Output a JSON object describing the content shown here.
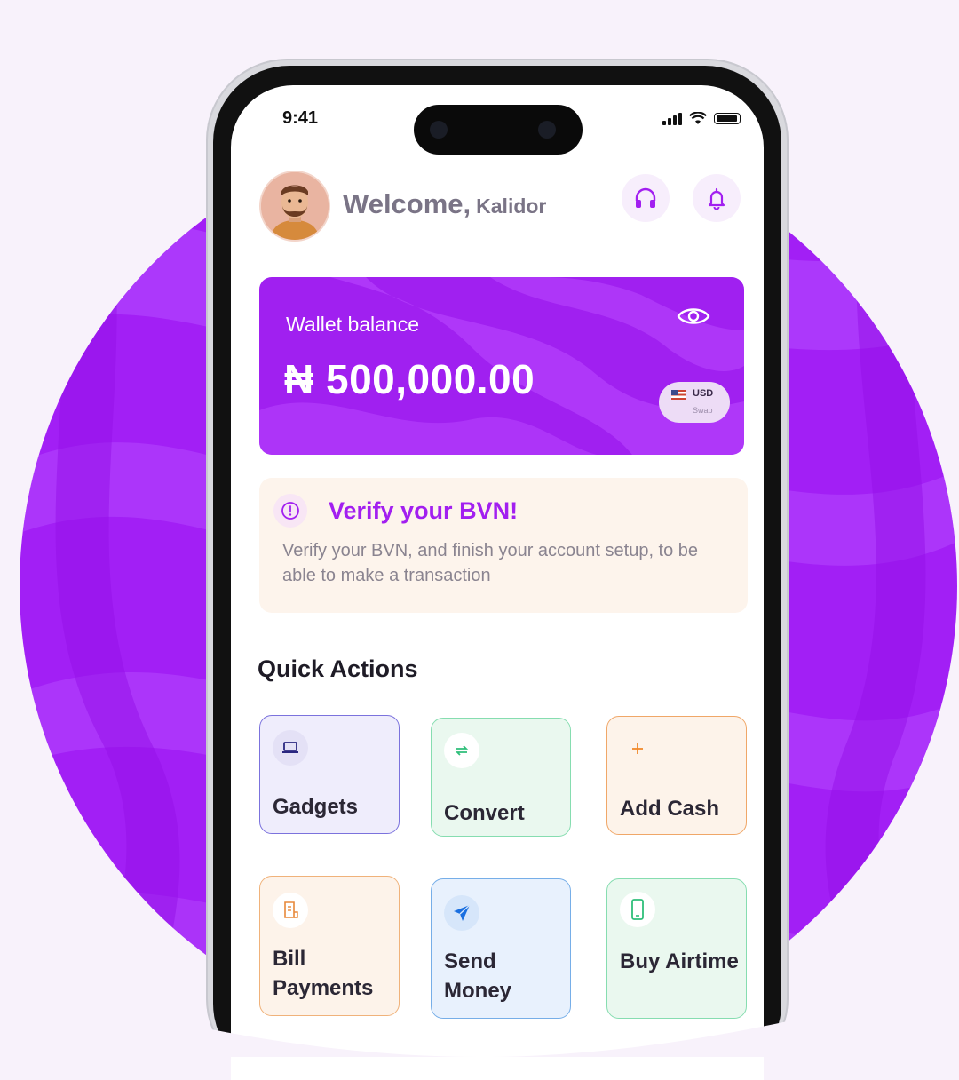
{
  "status_bar": {
    "time": "9:41"
  },
  "header": {
    "welcome_text": "Welcome,",
    "user_name": "Kalidor",
    "support_icon": "headphones-icon",
    "notifications_icon": "bell-icon"
  },
  "wallet": {
    "label": "Wallet balance",
    "amount": "₦ 500,000.00",
    "currency_label": "USD",
    "swap_label": "Swap",
    "visibility_icon": "eye-icon"
  },
  "bvn_notice": {
    "title": "Verify your BVN!",
    "message": "Verify your BVN, and finish your account setup, to be able to make a transaction"
  },
  "quick_actions": {
    "title": "Quick Actions",
    "items": [
      {
        "label": "Gadgets",
        "icon": "laptop-icon"
      },
      {
        "label": "Convert",
        "icon": "exchange-icon"
      },
      {
        "label": "Add Cash",
        "icon": "plus-icon"
      },
      {
        "label": "Bill Payments",
        "icon": "receipt-icon"
      },
      {
        "label": "Send Money",
        "icon": "send-icon"
      },
      {
        "label": "Buy Airtime",
        "icon": "phone-icon"
      }
    ]
  },
  "colors": {
    "brand_purple": "#a020f0",
    "background": "#f8f2fb",
    "bvn_title": "#a21ff0"
  }
}
